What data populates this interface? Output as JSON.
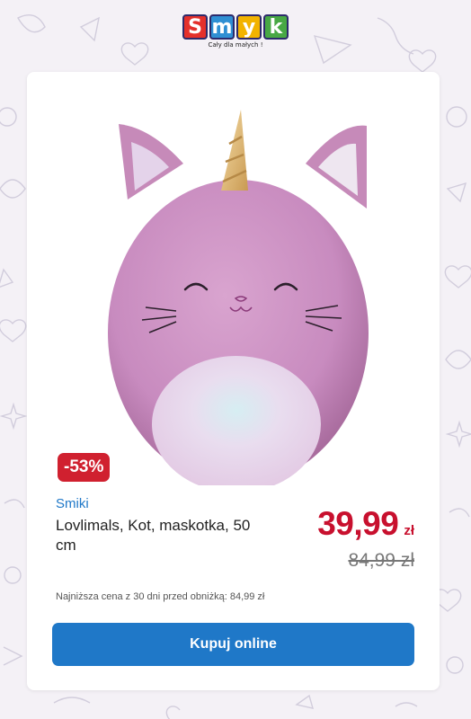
{
  "header": {
    "logo_letters": [
      "S",
      "m",
      "y",
      "k"
    ],
    "logo_colors": [
      "#e4302b",
      "#2f8fd3",
      "#f2b300",
      "#48a844"
    ],
    "tagline": "Cały dla małych !"
  },
  "product": {
    "discount": "-53%",
    "brand": "Smiki",
    "name": "Lovlimals, Kot, maskotka, 50 cm",
    "price_now": "39,99",
    "price_now_currency": "zł",
    "price_old": "84,99 zł",
    "lowest_price_note": "Najniższa cena z 30 dni przed obniżką: 84,99 zł",
    "buy_label": "Kupuj online"
  },
  "colors": {
    "accent_blue": "#1f78c8",
    "sale_red": "#d0202f",
    "price_red": "#c8102e"
  }
}
